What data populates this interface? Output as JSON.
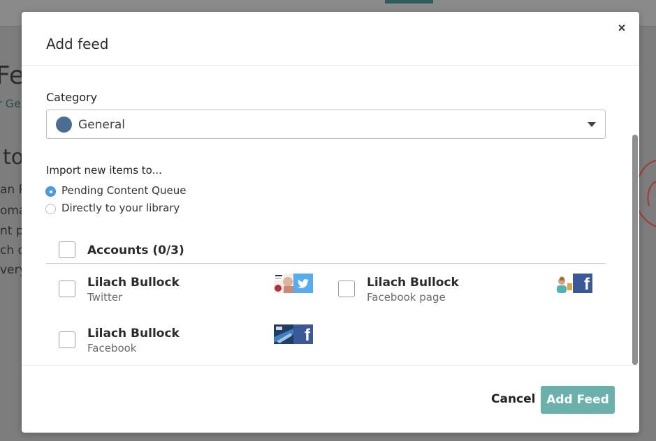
{
  "background": {
    "title_fragment": "Fe",
    "crumb_fragment": "r Ge",
    "heading_fragment": "to",
    "lines": [
      "an R",
      "oma",
      "nt pa",
      "ch o",
      "very"
    ]
  },
  "modal": {
    "title": "Add feed",
    "close_icon": "×",
    "category": {
      "label": "Category",
      "selected": "General",
      "color": "#4a6e93"
    },
    "import": {
      "label": "Import new items to...",
      "options": [
        {
          "label": "Pending Content Queue",
          "selected": true
        },
        {
          "label": "Directly to your library",
          "selected": false
        }
      ]
    },
    "accounts": {
      "header": "Accounts (0/3)",
      "items": [
        {
          "name": "Lilach Bullock",
          "type": "Twitter",
          "network_icon": "twitter-icon",
          "checked": false
        },
        {
          "name": "Lilach Bullock",
          "type": "Facebook page",
          "network_icon": "facebook-icon",
          "checked": false
        },
        {
          "name": "Lilach Bullock",
          "type": "Facebook",
          "network_icon": "facebook-icon",
          "checked": false
        }
      ]
    },
    "footer": {
      "cancel_label": "Cancel",
      "submit_label": "Add Feed"
    }
  },
  "colors": {
    "accent": "#6ab0ab",
    "radio_selected": "#4a9de0",
    "twitter": "#55acee",
    "facebook": "#3b5998"
  }
}
